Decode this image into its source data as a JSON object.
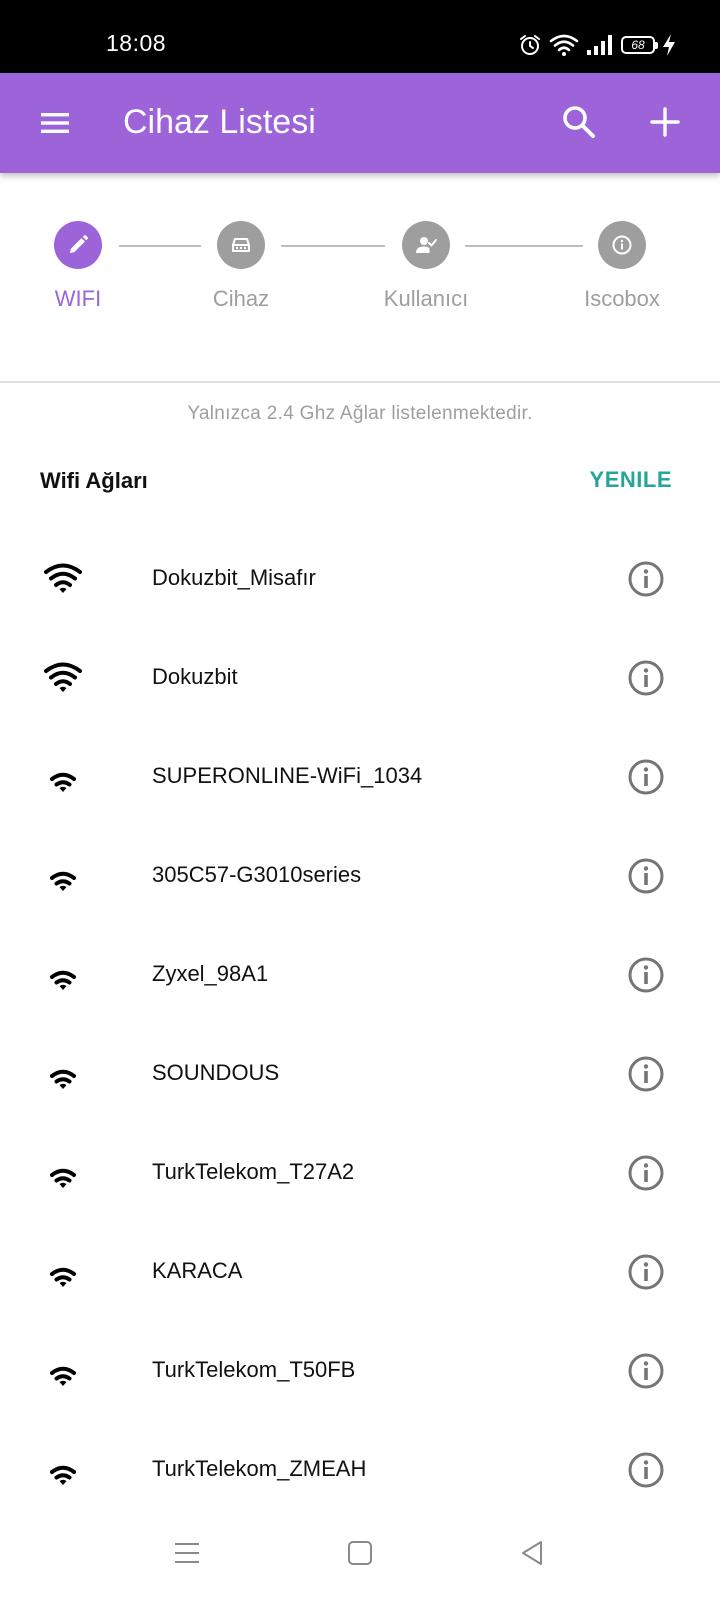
{
  "status_bar": {
    "time": "18:08",
    "battery": "68",
    "icons": [
      "alarm-icon",
      "wifi-status-icon",
      "cell-signal-icon",
      "battery-icon",
      "charging-icon"
    ]
  },
  "app_bar": {
    "title": "Cihaz Listesi",
    "background": "#9c64d8",
    "icons": [
      "menu-icon",
      "search-icon",
      "add-icon"
    ]
  },
  "stepper": {
    "accent": "#9c64d8",
    "inactive_color": "#9e9e9e",
    "steps": [
      {
        "label": "WIFI",
        "icon": "pencil-icon",
        "active": true
      },
      {
        "label": "Cihaz",
        "icon": "device-icon",
        "active": false
      },
      {
        "label": "Kullanıcı",
        "icon": "user-check-icon",
        "active": false
      },
      {
        "label": "Iscobox",
        "icon": "info-icon",
        "active": false
      }
    ]
  },
  "notice": "Yalnızca 2.4 Ghz Ağlar listelenmektedir.",
  "wifi_section": {
    "title": "Wifi Ağları",
    "refresh_label": "YENILE",
    "refresh_color": "#26a69a"
  },
  "networks": [
    {
      "ssid": "Dokuzbit_Misafır",
      "signal": "full"
    },
    {
      "ssid": "Dokuzbit",
      "signal": "full"
    },
    {
      "ssid": "SUPERONLINE-WiFi_1034",
      "signal": "low"
    },
    {
      "ssid": "305C57-G3010series",
      "signal": "low"
    },
    {
      "ssid": "Zyxel_98A1",
      "signal": "low"
    },
    {
      "ssid": "SOUNDOUS",
      "signal": "low"
    },
    {
      "ssid": "TurkTelekom_T27A2",
      "signal": "low"
    },
    {
      "ssid": "KARACA",
      "signal": "low"
    },
    {
      "ssid": "TurkTelekom_T50FB",
      "signal": "low"
    },
    {
      "ssid": "TurkTelekom_ZMEAH",
      "signal": "low"
    }
  ],
  "nav_bar": {
    "icons": [
      "recents-icon",
      "home-icon",
      "back-icon"
    ]
  }
}
